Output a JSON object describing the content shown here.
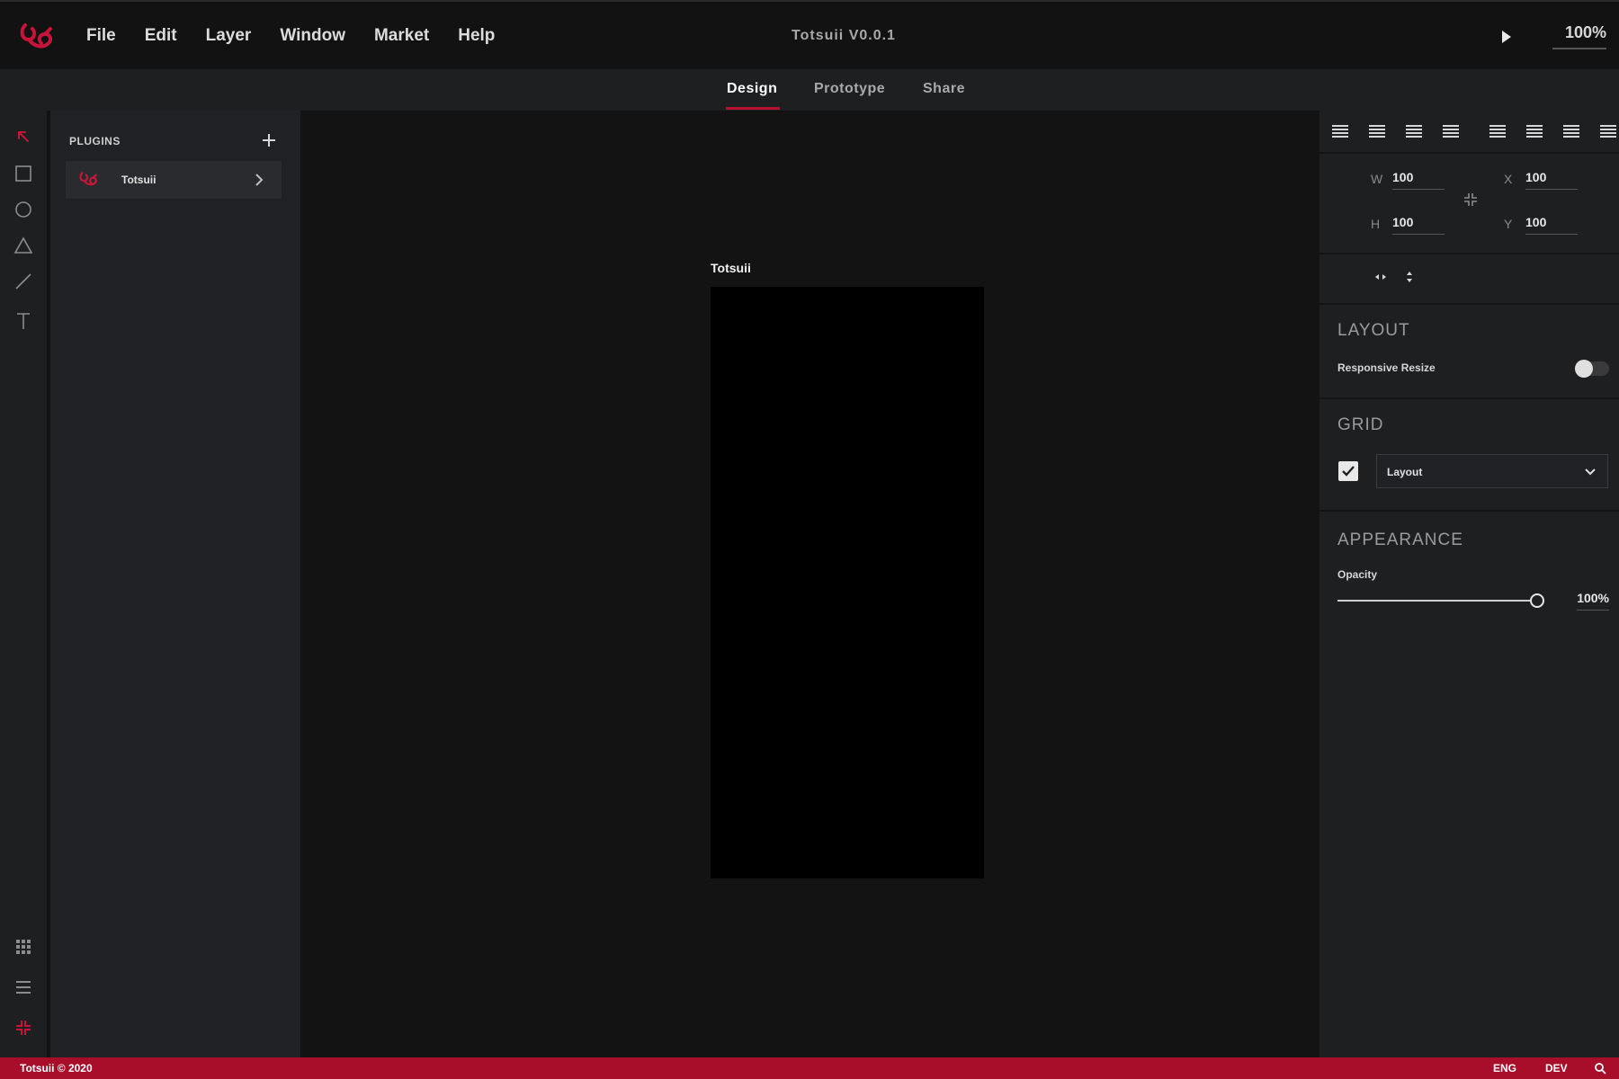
{
  "app": {
    "title": "Totsuii V0.0.1",
    "brand_color": "#b8102f",
    "logo_icon": "totsuii-logo-icon"
  },
  "menu": {
    "items": [
      "File",
      "Edit",
      "Layer",
      "Window",
      "Market",
      "Help"
    ]
  },
  "toolbar": {
    "play_icon": "play-icon",
    "zoom": "100%"
  },
  "tabs": {
    "items": [
      "Design",
      "Prototype",
      "Share"
    ],
    "active": "Design"
  },
  "tools": {
    "items": [
      "select-arrow-icon",
      "rectangle-icon",
      "ellipse-icon",
      "triangle-icon",
      "line-icon",
      "text-icon"
    ],
    "bottom": [
      "grid-icon",
      "layers-icon",
      "plugins-icon"
    ]
  },
  "plugins": {
    "title": "PLUGINS",
    "add_icon": "plus-icon",
    "items": [
      {
        "name": "Totsuii",
        "icon": "totsuii-logo-icon"
      }
    ]
  },
  "canvas": {
    "frame_label": "Totsuii"
  },
  "properties": {
    "dimensions": {
      "w_label": "W",
      "w": "100",
      "h_label": "H",
      "h": "100",
      "x_label": "X",
      "x": "100",
      "y_label": "Y",
      "y": "100"
    },
    "layout": {
      "title": "LAYOUT",
      "responsive_label": "Responsive Resize",
      "responsive_on": false
    },
    "grid": {
      "title": "GRID",
      "enabled": true,
      "type": "Layout"
    },
    "appearance": {
      "title": "APPEARANCE",
      "opacity_label": "Opacity",
      "opacity": "100%",
      "opacity_fraction": 1.0
    }
  },
  "status": {
    "copyright": "Totsuii © 2020",
    "language": "ENG",
    "mode": "DEV",
    "color": "#a80d29"
  }
}
